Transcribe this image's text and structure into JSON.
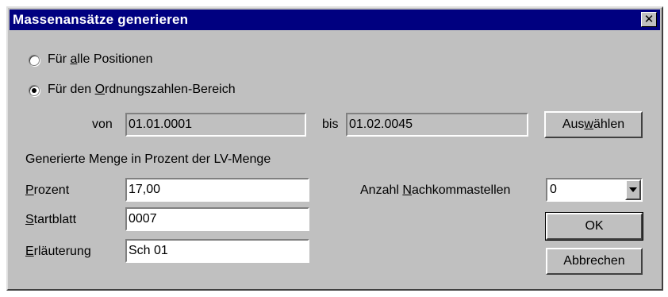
{
  "dialog": {
    "title": "Massenansätze generieren",
    "close_glyph": "✕"
  },
  "scope": {
    "option_all": {
      "pre": "Für ",
      "key": "a",
      "post": "lle Positionen",
      "selected": false
    },
    "option_range": {
      "pre": "Für den ",
      "key": "O",
      "post": "rdnungszahlen-Bereich",
      "selected": true
    }
  },
  "range": {
    "from_label": "von",
    "from_value": "01.01.0001",
    "to_label": "bis",
    "to_value": "01.02.0045",
    "select_button": {
      "pre": "Aus",
      "key": "w",
      "post": "ählen"
    }
  },
  "generated": {
    "heading": "Generierte Menge in Prozent der LV-Menge",
    "percent_label": {
      "key": "P",
      "post": "rozent"
    },
    "percent_value": "17,00",
    "startsheet_label": {
      "key": "S",
      "post": "tartblatt"
    },
    "startsheet_value": "0007",
    "explanation_label": {
      "key": "E",
      "post": "rläuterung"
    },
    "explanation_value": "Sch 01"
  },
  "decimals": {
    "label": {
      "pre": "Anzahl ",
      "key": "N",
      "post": "achkommastellen"
    },
    "value": "0"
  },
  "buttons": {
    "ok": "OK",
    "cancel": "Abbrechen"
  },
  "icons": {
    "close": "close-icon",
    "dropdown": "chevron-down-icon"
  }
}
